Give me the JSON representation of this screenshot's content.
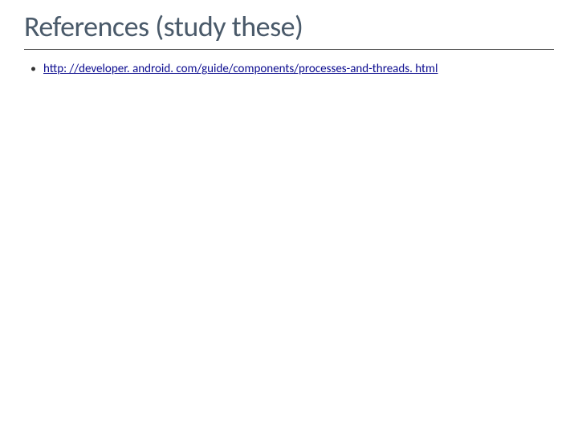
{
  "slide": {
    "title": "References (study these)",
    "bullets": [
      {
        "text": "http: //developer. android. com/guide/components/processes-and-threads. html",
        "is_link": true
      }
    ]
  }
}
